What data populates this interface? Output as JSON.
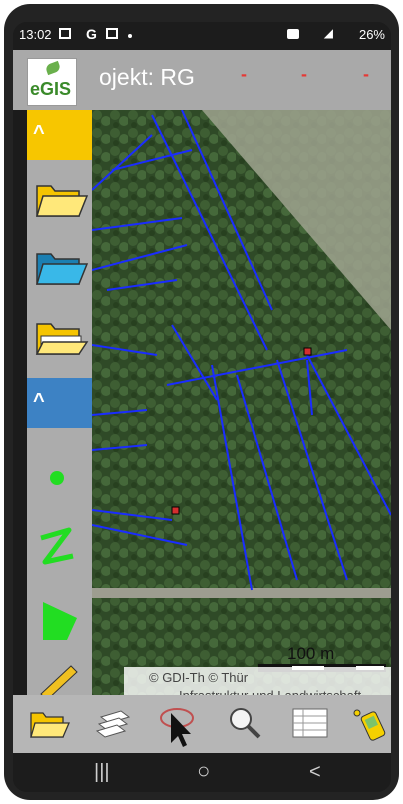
{
  "status_bar": {
    "time": "13:02",
    "g_label": "G",
    "battery": "26%"
  },
  "app_bar": {
    "logo_text": "eGIS",
    "project_title": "ojekt: RG",
    "markers": [
      "-",
      "-",
      "-"
    ]
  },
  "map": {
    "scale_label": "100 m",
    "attribution_line1": "© GDI-Th © Thür",
    "attribution_line2": "Infrastruktur und Landwirtschaft"
  },
  "sidebar": {
    "items": [
      {
        "name": "collapse-yellow",
        "glyph": "^"
      },
      {
        "name": "folder-open-icon"
      },
      {
        "name": "folder-blue-icon"
      },
      {
        "name": "folder-open-white-icon"
      },
      {
        "name": "collapse-blue",
        "glyph": "^"
      },
      {
        "name": "point-tool-icon"
      },
      {
        "name": "line-tool-icon"
      },
      {
        "name": "polygon-tool-icon"
      },
      {
        "name": "measure-ruler-icon"
      }
    ]
  },
  "toolbar": {
    "items": [
      "folder-icon",
      "layers-icon",
      "select-lasso-icon",
      "search-zoom-icon",
      "attribute-table-icon",
      "gps-device-icon"
    ]
  },
  "nav_bar": {
    "recents": "|||",
    "home": "○",
    "back": "<"
  },
  "colors": {
    "accent_yellow": "#f7c600",
    "accent_blue": "#3d82c4",
    "map_lines": "#1a2cff",
    "marker_red": "#d32f2f"
  }
}
